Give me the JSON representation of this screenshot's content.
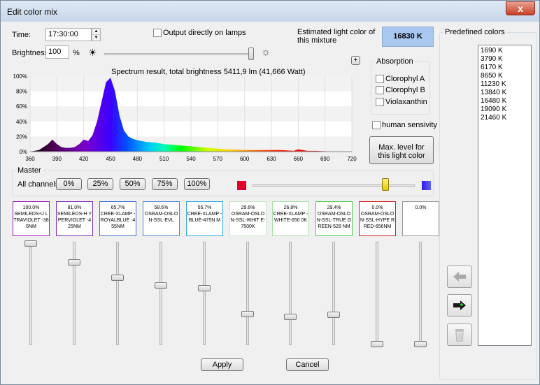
{
  "window": {
    "title": "Edit color mix",
    "close_label": "x"
  },
  "time": {
    "label": "Time:",
    "value": "17:30:00"
  },
  "brightness": {
    "label": "Brightness:",
    "value": "100",
    "unit": "%"
  },
  "output_lamps": {
    "label": "Output directly on lamps",
    "checked": false
  },
  "estimated": {
    "label": "Estimated light color of this mixture",
    "value": "16830 K"
  },
  "plus_button": "+",
  "absorption": {
    "title": "Absorption",
    "items": [
      "Clorophyl A",
      "Clorophyl B",
      "Violaxanthin"
    ]
  },
  "human_sensitivity": "human sensivity",
  "max_level_button": "Max. level for this light color",
  "predefined": {
    "title": "Predefined colors",
    "items": [
      "1690 K",
      "3790 K",
      "6170 K",
      "8650 K",
      "11230 K",
      "13840 K",
      "16480 K",
      "19090 K",
      "21460 K"
    ]
  },
  "chart_data": {
    "type": "area",
    "title": "Spectrum result, total brightness 5411,9 lm (41,666 Watt)",
    "xlabel": "",
    "ylabel": "",
    "xlim": [
      360,
      720
    ],
    "ylim": [
      0,
      100
    ],
    "x_ticks": [
      "360",
      "390",
      "420",
      "450",
      "480",
      "510",
      "540",
      "570",
      "600",
      "630",
      "660",
      "690",
      "720"
    ],
    "y_ticks": [
      "100%",
      "80%",
      "60%",
      "40%",
      "20%",
      "0%"
    ],
    "grid": true,
    "x": [
      360,
      370,
      375,
      380,
      385,
      390,
      395,
      400,
      405,
      410,
      415,
      420,
      425,
      430,
      435,
      440,
      445,
      450,
      455,
      460,
      465,
      470,
      475,
      480,
      490,
      500,
      510,
      520,
      530,
      540,
      550,
      560,
      570,
      580,
      600,
      620,
      640,
      655,
      660,
      670,
      680,
      700,
      710,
      720
    ],
    "y": [
      0,
      2,
      6,
      10,
      16,
      10,
      6,
      5,
      5,
      6,
      10,
      16,
      14,
      22,
      40,
      66,
      92,
      98,
      80,
      48,
      28,
      20,
      17,
      15,
      13,
      12,
      10,
      9,
      8,
      7,
      6,
      5,
      4,
      3,
      2,
      2,
      2,
      1,
      3,
      1,
      1,
      0,
      0,
      0
    ]
  },
  "master": {
    "title": "Master",
    "all_channels": "All channels",
    "buttons": [
      "0%",
      "25%",
      "50%",
      "75%",
      "100%"
    ],
    "level": 0.82
  },
  "channels": [
    {
      "pct": "100.0%",
      "name": "SEMILEDS-U LTRAVIOLET -385NM",
      "color": "#9a1ab0",
      "level": 1.0
    },
    {
      "pct": "81.0%",
      "name": "SEMILEDS-H YPERVIOLET -425NM",
      "color": "#7a2ab8",
      "level": 0.81
    },
    {
      "pct": "65.7%",
      "name": "CREE-XLAMP -ROYALBLUE -455NM",
      "color": "#3a6fd0",
      "level": 0.657
    },
    {
      "pct": "58.6%",
      "name": "OSRAM-OSLO N-SSL-EVL",
      "color": "#4a8ad0",
      "level": 0.586
    },
    {
      "pct": "55.7%",
      "name": "CREE-XLAMP -BLUE-475N M",
      "color": "#30a8e0",
      "level": 0.557
    },
    {
      "pct": "29.6%",
      "name": "OSRAM-OSLO N-SSL-WHIT E-7500K",
      "color": "#c8e8c8",
      "level": 0.296
    },
    {
      "pct": "26.8%",
      "name": "CREE-XLAMP -WHITE-650 0K",
      "color": "#a8e0a8",
      "level": 0.268
    },
    {
      "pct": "29.4%",
      "name": "OSRAM-OSLO N-SSL-TRUE GREEN-528 NM",
      "color": "#50c850",
      "level": 0.294
    },
    {
      "pct": "0.0%",
      "name": "OSRAM-OSLO N-SSL-HYPE RRED-656NM",
      "color": "#d02020",
      "level": 0.0
    },
    {
      "pct": "0.0%",
      "name": "",
      "color": "#999999",
      "level": 0.0
    }
  ],
  "apply_label": "Apply",
  "cancel_label": "Cancel"
}
